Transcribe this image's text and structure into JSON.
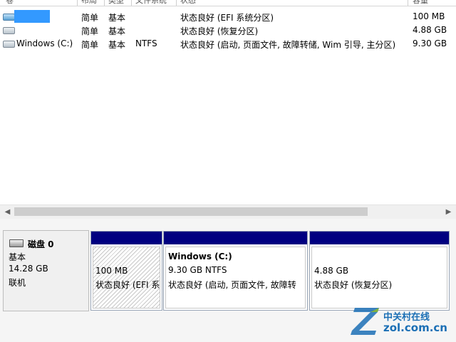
{
  "columns": {
    "volume": "卷",
    "layout": "布局",
    "type": "类型",
    "filesystem": "文件系统",
    "status": "状态",
    "capacity": "容量"
  },
  "volumes": [
    {
      "icon": "drive-icon",
      "name": "",
      "layout": "简单",
      "type": "基本",
      "filesystem": "",
      "status": "状态良好 (EFI 系统分区)",
      "capacity": "100 MB",
      "selected": true
    },
    {
      "icon": "drive-icon",
      "name": "",
      "layout": "简单",
      "type": "基本",
      "filesystem": "",
      "status": "状态良好 (恢复分区)",
      "capacity": "4.88 GB"
    },
    {
      "icon": "drive-icon",
      "name": "Windows (C:)",
      "layout": "简单",
      "type": "基本",
      "filesystem": "NTFS",
      "status": "状态良好 (启动, 页面文件, 故障转储, Wim 引导, 主分区)",
      "capacity": "9.30 GB"
    }
  ],
  "disk": {
    "icon": "disk-icon",
    "name": "磁盘 0",
    "type": "基本",
    "size": "14.28 GB",
    "status": "联机"
  },
  "partitions": [
    {
      "size": "100 MB",
      "status": "状态良好 (EFI 系",
      "hatched": true
    },
    {
      "name": "Windows (C:)",
      "size_fs": "9.30 GB NTFS",
      "status": "状态良好 (启动, 页面文件, 故障转"
    },
    {
      "size": "4.88 GB",
      "status": "状态良好 (恢复分区)"
    }
  ],
  "colors": {
    "partition_band": "#000080",
    "selection": "#3399ff",
    "watermark": "#1b6fb5"
  },
  "watermark": {
    "name": "中关村在线",
    "url": "zol.com.cn",
    "logo": "zol-logo"
  }
}
